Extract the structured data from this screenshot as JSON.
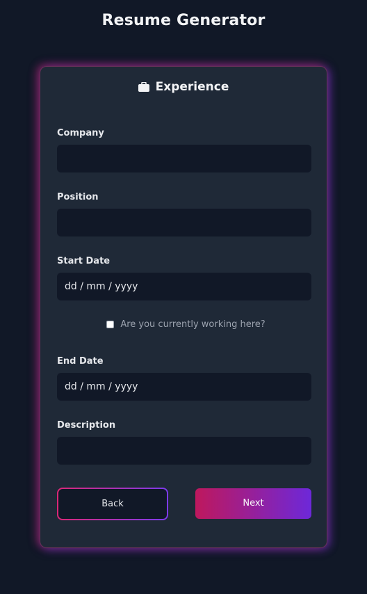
{
  "page": {
    "title": "Resume Generator"
  },
  "section": {
    "title": "Experience",
    "icon": "briefcase-icon"
  },
  "fields": {
    "company": {
      "label": "Company",
      "value": ""
    },
    "position": {
      "label": "Position",
      "value": ""
    },
    "start_date": {
      "label": "Start Date",
      "value": "dd / mm / yyyy"
    },
    "currently_working": {
      "label": "Are you currently working here?",
      "checked": false
    },
    "end_date": {
      "label": "End Date",
      "value": "dd / mm / yyyy"
    },
    "description": {
      "label": "Description",
      "value": ""
    }
  },
  "actions": {
    "back_label": "Back",
    "next_label": "Next"
  },
  "colors": {
    "background": "#111827",
    "card": "#1f2937",
    "input": "#111827",
    "accent_pink": "#db2777",
    "accent_purple": "#7c3aed"
  }
}
